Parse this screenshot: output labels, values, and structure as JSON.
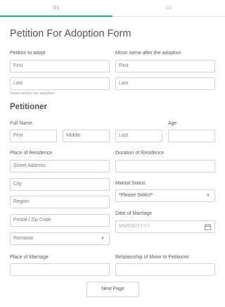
{
  "steps": {
    "step1": "01",
    "step2": "02",
    "progress": 0.5
  },
  "form": {
    "title": "Petition For Adoption Form",
    "petition_to_adopt": {
      "label": "Petition to adopt",
      "first": "First",
      "last": "Last",
      "hint": "Name before the adoption"
    },
    "minor_name": {
      "label": "Minor name after the adoption",
      "first": "First",
      "last": "Last"
    },
    "petitioner_section": "Petitioner",
    "full_name": {
      "label": "Full Name",
      "first": "First",
      "middle": "Middle",
      "last": "Last"
    },
    "age": {
      "label": "Age",
      "value": ""
    },
    "place_of_residence": {
      "label": "Place of Residence",
      "street": "Street Address",
      "city": "City",
      "region": "Region",
      "postal": "Postal / Zip Code",
      "country": "Romania"
    },
    "duration_of_residence": {
      "label": "Duration of Residence",
      "value": ""
    },
    "marital_status": {
      "label": "Marital Status",
      "value": "*Please Select*"
    },
    "date_of_marriage": {
      "label": "Date of Marriage",
      "placeholder": "MM/DD/YYYY"
    },
    "place_of_marriage": {
      "label": "Place of Marriage",
      "value": ""
    },
    "relationship": {
      "label": "Relationship of Minor to Petitioner",
      "value": ""
    },
    "next_button": "Next Page"
  },
  "icons": {
    "calendar": "calendar-icon",
    "dropdown": "chevron-down-icon"
  },
  "colors": {
    "accent": "#1fae8f",
    "border": "#cfd3d8"
  }
}
